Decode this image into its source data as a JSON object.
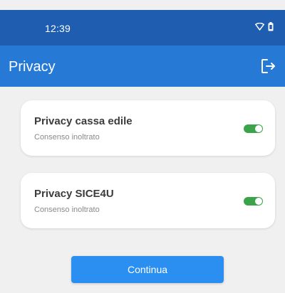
{
  "status_bar": {
    "time": "12:39",
    "icons": [
      "wifi-icon",
      "battery-icon"
    ]
  },
  "app_bar": {
    "title": "Privacy",
    "action_icon": "logout-icon"
  },
  "cards": [
    {
      "title": "Privacy cassa edile",
      "subtitle": "Consenso inoltrato",
      "toggle_on": true
    },
    {
      "title": "Privacy SICE4U",
      "subtitle": "Consenso inoltrato",
      "toggle_on": true
    }
  ],
  "continue_button": {
    "label": "Continua"
  },
  "colors": {
    "status_bar": "#1e5db0",
    "app_bar": "#2779d6",
    "toggle_on": "#3ba44a",
    "button": "#2a8ff0",
    "background": "#f0f0f0"
  }
}
